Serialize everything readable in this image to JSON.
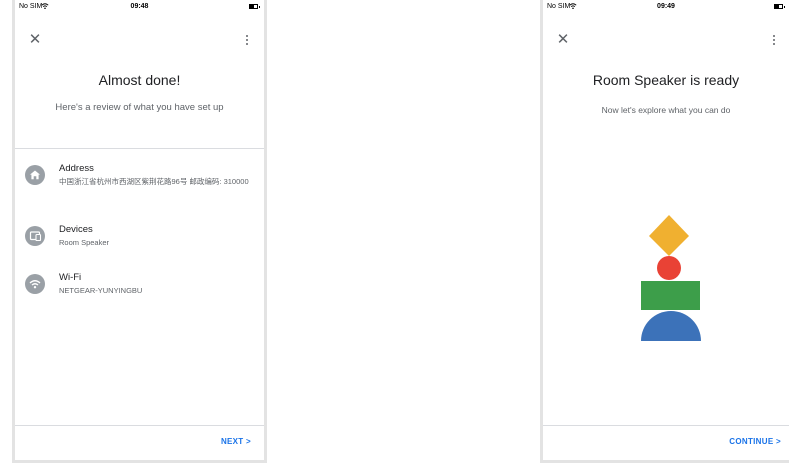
{
  "left_screen": {
    "status_bar": {
      "carrier": "No SIM",
      "time": "09:48"
    },
    "title": "Almost done!",
    "subtitle": "Here's a review of what you have set up",
    "items": [
      {
        "icon": "home-icon",
        "label": "Address",
        "value": "中国浙江省杭州市西湖区紫荆花路96号 邮政编码: 310000"
      },
      {
        "icon": "device-icon",
        "label": "Devices",
        "value": "Room Speaker"
      },
      {
        "icon": "wifi-icon",
        "label": "Wi-Fi",
        "value": "NETGEAR-YUNYINGBU"
      }
    ],
    "next_label": "NEXT"
  },
  "right_screen": {
    "status_bar": {
      "carrier": "No SIM",
      "time": "09:49"
    },
    "title": "Room Speaker is ready",
    "subtitle": "Now let's explore what you can do",
    "continue_label": "CONTINUE",
    "illustration_colors": {
      "diamond": "#F0B030",
      "circle": "#E94235",
      "rectangle": "#3D9E4A",
      "half_circle": "#3C72B9"
    }
  },
  "colors": {
    "accent": "#1a73e8",
    "icon_bg": "#9aa0a6",
    "divider": "#dadce0"
  }
}
